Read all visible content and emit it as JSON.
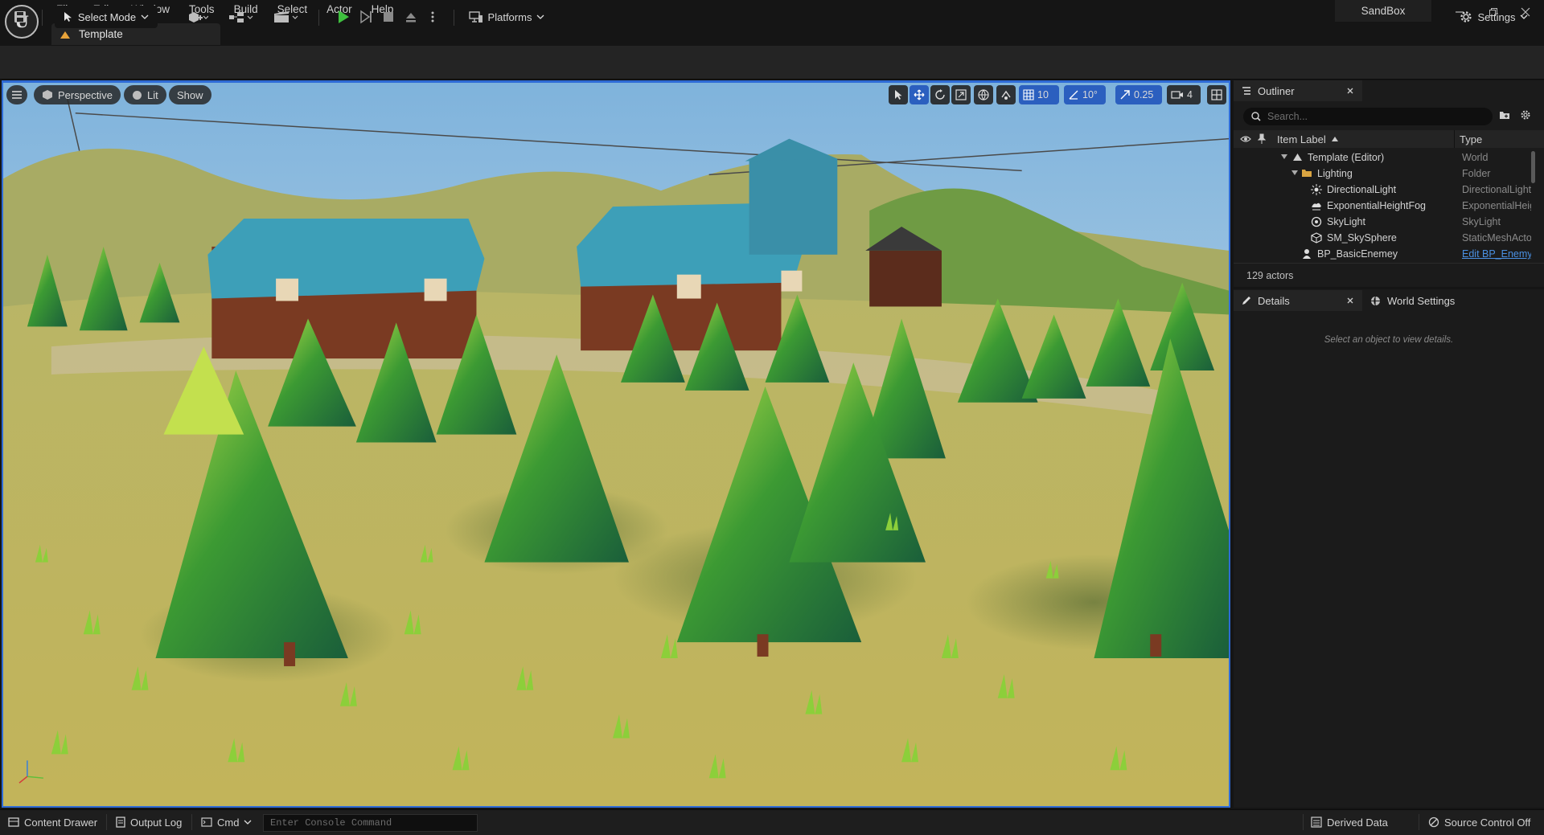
{
  "menu": [
    "File",
    "Edit",
    "Window",
    "Tools",
    "Build",
    "Select",
    "Actor",
    "Help"
  ],
  "document_tab": "Template",
  "project_name": "SandBox",
  "toolbar": {
    "select_mode": "Select Mode",
    "platforms": "Platforms",
    "settings": "Settings"
  },
  "viewport": {
    "perspective": "Perspective",
    "lit": "Lit",
    "show": "Show",
    "grid_snap": "10",
    "rotation_snap": "10°",
    "scale_snap": "0.25",
    "camera_speed": "4"
  },
  "outliner": {
    "tab_label": "Outliner",
    "search_placeholder": "Search...",
    "col_label": "Item Label",
    "col_type": "Type",
    "rows": [
      {
        "name": "Template (Editor)",
        "type": "World"
      },
      {
        "name": "Lighting",
        "type": "Folder"
      },
      {
        "name": "DirectionalLight",
        "type": "DirectionalLight"
      },
      {
        "name": "ExponentialHeightFog",
        "type": "ExponentialHeightFog"
      },
      {
        "name": "SkyLight",
        "type": "SkyLight"
      },
      {
        "name": "SM_SkySphere",
        "type": "StaticMeshActor"
      },
      {
        "name": "BP_BasicEnemey",
        "type": "Edit BP_Enemy"
      }
    ],
    "actor_count": "129 actors"
  },
  "details": {
    "tab_label": "Details",
    "world_settings_label": "World Settings",
    "empty_message": "Select an object to view details."
  },
  "statusbar": {
    "content_drawer": "Content Drawer",
    "output_log": "Output Log",
    "cmd": "Cmd",
    "console_placeholder": "Enter Console Command",
    "derived_data": "Derived Data",
    "source_control": "Source Control Off"
  },
  "colors": {
    "accent": "#2e6bd6",
    "play_green": "#3fbf3f",
    "link_blue": "#4a90e2",
    "grass": "#b9b35e",
    "sky": "#8fbce0",
    "tree": "#2a8f3a",
    "roof": "#3fa3b8"
  }
}
